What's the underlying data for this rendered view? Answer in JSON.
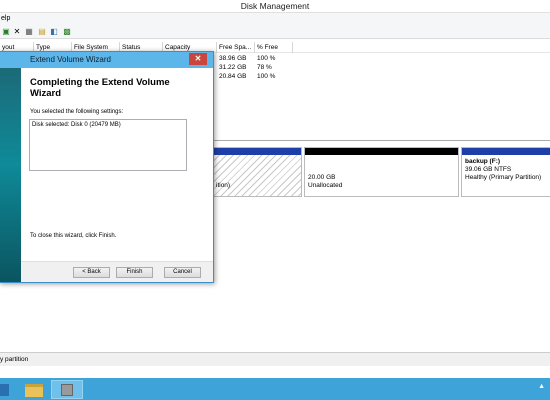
{
  "window": {
    "title": "Disk Management"
  },
  "menu": {
    "items": [
      "elp"
    ]
  },
  "toolbar": {
    "icons": [
      "properties-icon",
      "delete-icon",
      "help-icon",
      "open-icon",
      "explore-icon",
      "refresh-icon"
    ]
  },
  "volume_table": {
    "columns": [
      "yout",
      "Type",
      "File System",
      "Status",
      "Capacity",
      "Free Spa...",
      "% Free"
    ],
    "rows": [
      {
        "free": "38.96 GB",
        "pct": "100 %"
      },
      {
        "free": "31.22 GB",
        "pct": "78 %"
      },
      {
        "free": "20.84 GB",
        "pct": "100 %"
      }
    ]
  },
  "disk_map": {
    "partitions": [
      {
        "name": "",
        "line1": "",
        "line2": "ition)",
        "style": "hatched"
      },
      {
        "name": "",
        "line1": "20.00 GB",
        "line2": "Unallocated",
        "style": "unallocated"
      },
      {
        "name": "backup  (F:)",
        "line1": "39.06 GB NTFS",
        "line2": "Healthy (Primary Partition)",
        "style": "primary"
      }
    ]
  },
  "status_bar": {
    "text": "y partition"
  },
  "wizard": {
    "title": "Extend Volume Wizard",
    "heading": "Completing the Extend Volume Wizard",
    "subtitle": "You selected the following settings:",
    "settings": "Disk selected: Disk 0 (20479 MB)",
    "close_note": "To close this wizard, click Finish.",
    "buttons": {
      "back": "< Back",
      "finish": "Finish",
      "cancel": "Cancel"
    }
  },
  "taskbar": {
    "tray": "▲"
  },
  "colors": {
    "taskbar": "#3ea3d9",
    "wizard_title": "#5cb6ea",
    "close": "#c9463d",
    "primary_bar": "#1f3fa8"
  }
}
